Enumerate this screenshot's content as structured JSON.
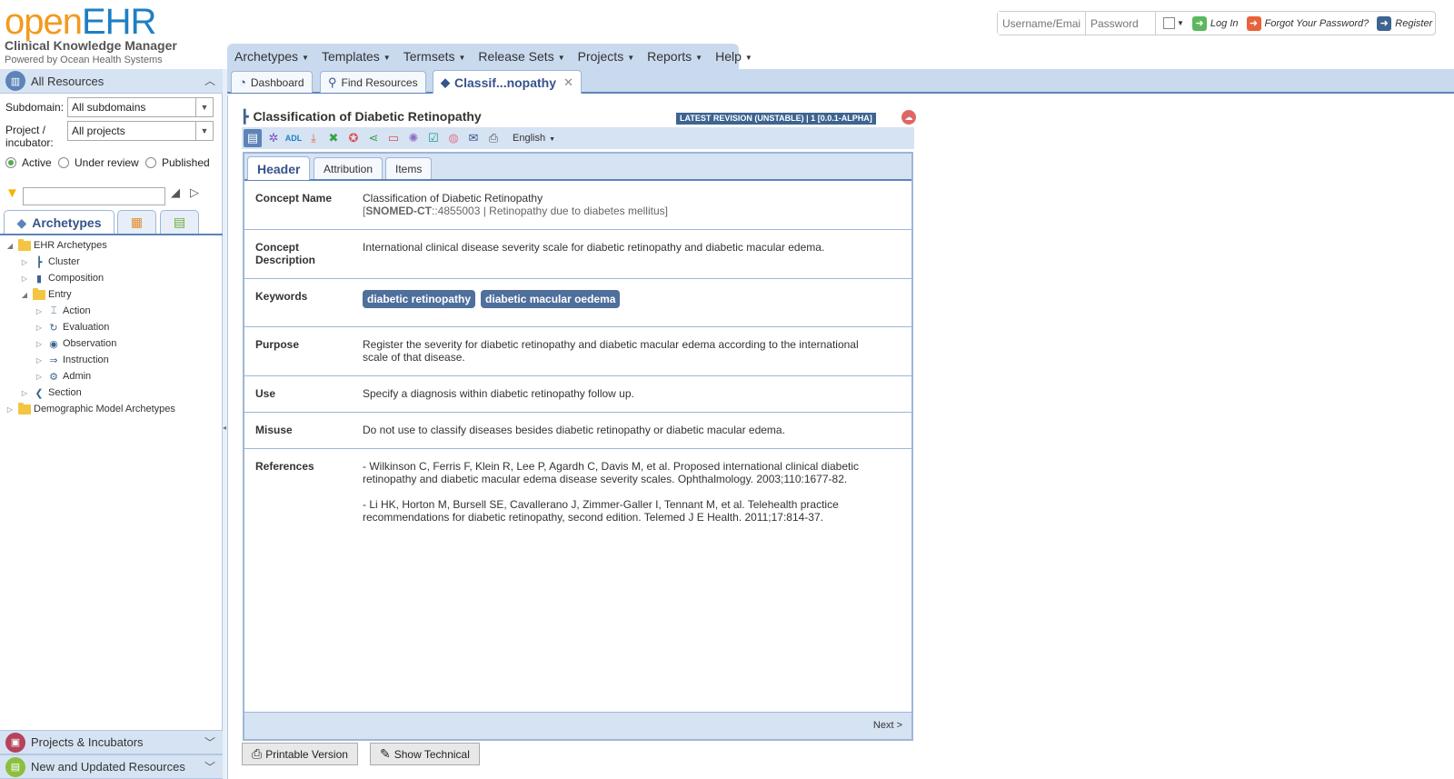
{
  "header": {
    "logo_open": "open",
    "logo_ehr": "EHR",
    "app_name": "Clinical Knowledge Manager",
    "powered_by": "Powered by Ocean Health Systems"
  },
  "login": {
    "username_placeholder": "Username/Email",
    "password_placeholder": "Password",
    "login_label": "Log In",
    "forgot_label": "Forgot Your Password?",
    "register_label": "Register"
  },
  "menubar": [
    "Archetypes",
    "Templates",
    "Termsets",
    "Release Sets",
    "Projects",
    "Reports",
    "Help"
  ],
  "left_panel": {
    "title": "All Resources",
    "subdomain_label": "Subdomain:",
    "subdomain_value": "All subdomains",
    "project_label_1": "Project /",
    "project_label_2": "incubator:",
    "project_value": "All projects",
    "status_options": [
      "Active",
      "Under review",
      "Published"
    ],
    "status_selected": "Active",
    "tab_archetypes": "Archetypes",
    "tree": {
      "root": "EHR Archetypes",
      "cluster": "Cluster",
      "composition": "Composition",
      "entry": "Entry",
      "action": "Action",
      "evaluation": "Evaluation",
      "observation": "Observation",
      "instruction": "Instruction",
      "admin": "Admin",
      "section": "Section",
      "demographic": "Demographic Model Archetypes"
    },
    "projects_incubators": "Projects & Incubators",
    "new_updated": "New and Updated Resources"
  },
  "main_tabs": {
    "dashboard": "Dashboard",
    "find_resources": "Find Resources",
    "active": "Classif...nopathy"
  },
  "resource": {
    "title": "Classification of Diabetic Retinopathy",
    "revision_badge": "LATEST REVISION (UNSTABLE) | 1 [0.0.1-ALPHA]",
    "language": "English"
  },
  "detail_tabs": [
    "Header",
    "Attribution",
    "Items"
  ],
  "header_rows": {
    "concept_name_label": "Concept Name",
    "concept_name_value": "Classification of Diabetic Retinopathy",
    "snomed_open": "[",
    "snomed_code_label": "SNOMED-CT",
    "snomed_rest": "::4855003 | Retinopathy due to diabetes mellitus]",
    "concept_desc_label_1": "Concept",
    "concept_desc_label_2": "Description",
    "concept_desc_value": "International clinical disease severity scale for diabetic retinopathy and diabetic macular edema.",
    "keywords_label": "Keywords",
    "keywords": [
      "diabetic retinopathy",
      "diabetic macular oedema"
    ],
    "purpose_label": "Purpose",
    "purpose_value": "Register the severity for diabetic retinopathy and diabetic macular edema according to the international scale of that disease.",
    "use_label": "Use",
    "use_value": "Specify a diagnosis within diabetic retinopathy follow up.",
    "misuse_label": "Misuse",
    "misuse_value": "Do not use to classify diseases besides diabetic retinopathy or diabetic macular edema.",
    "references_label": "References",
    "reference_1": "- Wilkinson C, Ferris F, Klein R, Lee P, Agardh C, Davis M, et al. Proposed international clinical diabetic retinopathy and diabetic macular edema disease severity scales. Ophthalmology. 2003;110:1677-82.",
    "reference_2": "- Li HK, Horton M, Bursell SE, Cavallerano J, Zimmer-Galler I, Tennant M, et al. Telehealth practice recommendations for diabetic retinopathy, second edition. Telemed J E Health. 2011;17:814-37."
  },
  "next_label": "Next >",
  "buttons": {
    "printable": "Printable Version",
    "show_technical": "Show Technical"
  },
  "colors": {
    "accent": "#5d84b8",
    "panel_bg": "#d6e3f3",
    "keyword_bg": "#4f6f9c",
    "logo_orange": "#f39a1e",
    "logo_blue": "#1d7fc4"
  }
}
